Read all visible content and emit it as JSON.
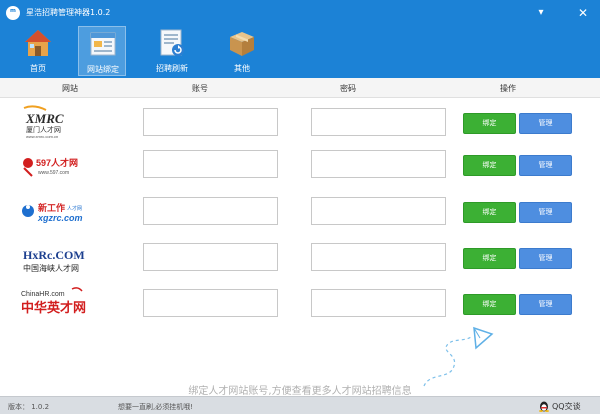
{
  "window": {
    "title": "星浩招聘管理神器1.0.2",
    "min_glyph": "▾",
    "close_glyph": "✕"
  },
  "toolbar": {
    "items": [
      {
        "label": "首页",
        "icon": "home-icon"
      },
      {
        "label": "网站绑定",
        "icon": "website-bind-icon",
        "active": true
      },
      {
        "label": "招聘刷新",
        "icon": "refresh-icon"
      },
      {
        "label": "其他",
        "icon": "box-icon"
      }
    ]
  },
  "table": {
    "headers": [
      "网站",
      "账号",
      "密码",
      "操作"
    ],
    "rows": [
      {
        "site": "XMRC 厦门人才网",
        "account": "",
        "password": "",
        "bind_label": "绑定",
        "manage_label": "管理"
      },
      {
        "site": "597人才网",
        "account": "",
        "password": "",
        "bind_label": "绑定",
        "manage_label": "管理"
      },
      {
        "site": "新工作 xgzrc.com",
        "account": "",
        "password": "",
        "bind_label": "绑定",
        "manage_label": "管理"
      },
      {
        "site": "HXRC.COM 中国海峡人才网",
        "account": "",
        "password": "",
        "bind_label": "绑定",
        "manage_label": "管理"
      },
      {
        "site": "ChinaHR.com 中华英才网",
        "account": "",
        "password": "",
        "bind_label": "绑定",
        "manage_label": "管理"
      }
    ]
  },
  "logos": {
    "xmrc_text": "XMRC",
    "xmrc_cn": "厦门人才网",
    "xmrc_url": "www.xmrc.com.cn",
    "r597_text": "597人才网",
    "r597_url": "www.597.com",
    "xgz_text": "新工作",
    "xgz_sub": "人才网",
    "xgz_url": "xgzrc.com",
    "hxrc_text": "HxRc.COM",
    "hxrc_cn": "中国海峡人才网",
    "chinahr_text": "ChinaHR.com",
    "chinahr_cn": "中华英才网"
  },
  "hint": "绑定人才网站账号,方便查看更多人才网站招聘信息",
  "status": {
    "version": "版本： 1.0.2",
    "message": "想要一直刷,必须挂机哦!",
    "qq_label": "QQ交谈"
  },
  "colors": {
    "titlebar": "#1c82d6",
    "bind_button": "#3cb034",
    "manage_button": "#4e8ee0"
  }
}
